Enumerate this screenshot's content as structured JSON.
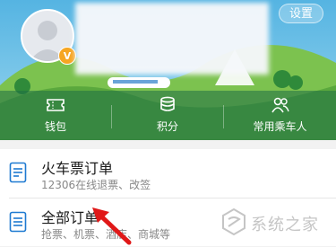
{
  "header": {
    "settings_label": "设置",
    "vip_badge": "V"
  },
  "tabs": [
    {
      "label": "钱包",
      "icon": "ticket-icon"
    },
    {
      "label": "积分",
      "icon": "coins-icon"
    },
    {
      "label": "常用乘车人",
      "icon": "people-icon"
    }
  ],
  "orders": [
    {
      "title": "火车票订单",
      "subtitle": "12306在线退票、改签",
      "icon": "ticket-doc-icon"
    },
    {
      "title": "全部订单",
      "subtitle": "抢票、机票、酒店、商城等",
      "icon": "list-doc-icon"
    }
  ],
  "watermark": {
    "text": "系统之家"
  },
  "colors": {
    "sky": "#6fc0e6",
    "hill": "#6ab54a",
    "accent": "#1e7ad1",
    "arrow": "#e01818"
  }
}
